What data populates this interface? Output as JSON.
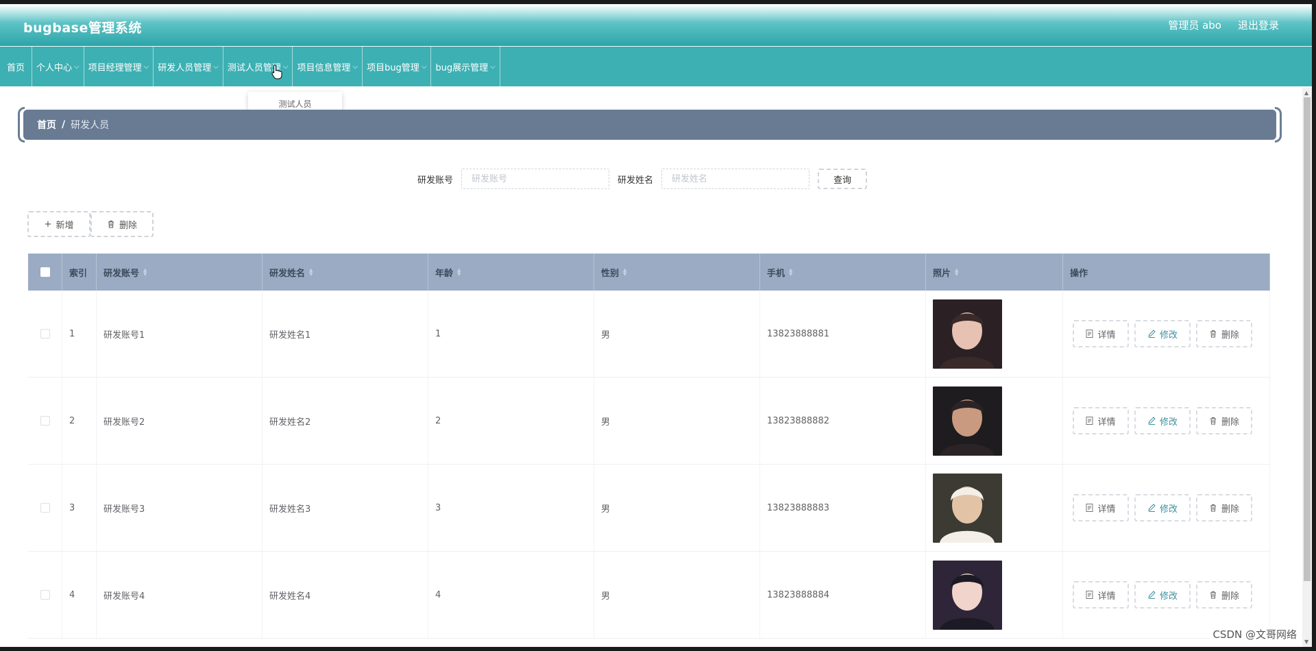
{
  "header": {
    "brand": "bugbase管理系统",
    "user": "管理员 abo",
    "logout": "退出登录"
  },
  "nav": {
    "home": "首页",
    "items": [
      "个人中心",
      "项目经理管理",
      "研发人员管理",
      "测试人员管理",
      "项目信息管理",
      "项目bug管理",
      "bug展示管理"
    ],
    "dropdown_item": "测试人员"
  },
  "breadcrumb": {
    "home": "首页",
    "sep": "/",
    "current": "研发人员"
  },
  "search": {
    "account_label": "研发账号",
    "account_placeholder": "研发账号",
    "name_label": "研发姓名",
    "name_placeholder": "研发姓名",
    "query_button": "查询"
  },
  "actions": {
    "add": "新增",
    "delete": "删除"
  },
  "table": {
    "columns": [
      "索引",
      "研发账号",
      "研发姓名",
      "年龄",
      "性别",
      "手机",
      "照片",
      "操作"
    ],
    "op_labels": {
      "detail": "详情",
      "edit": "修改",
      "delete": "删除"
    },
    "rows": [
      {
        "index": "1",
        "account": "研发账号1",
        "name": "研发姓名1",
        "age": "1",
        "sex": "男",
        "phone": "13823888881"
      },
      {
        "index": "2",
        "account": "研发账号2",
        "name": "研发姓名2",
        "age": "2",
        "sex": "男",
        "phone": "13823888882"
      },
      {
        "index": "3",
        "account": "研发账号3",
        "name": "研发姓名3",
        "age": "3",
        "sex": "男",
        "phone": "13823888883"
      },
      {
        "index": "4",
        "account": "研发账号4",
        "name": "研发姓名4",
        "age": "4",
        "sex": "男",
        "phone": "13823888884"
      }
    ]
  },
  "watermark": "CSDN @文哥网络",
  "colors": {
    "header": "#2ea6ab",
    "nav": "#3db0b3",
    "breadcrumb": "#687b93",
    "table_header": "#9aabc3"
  }
}
